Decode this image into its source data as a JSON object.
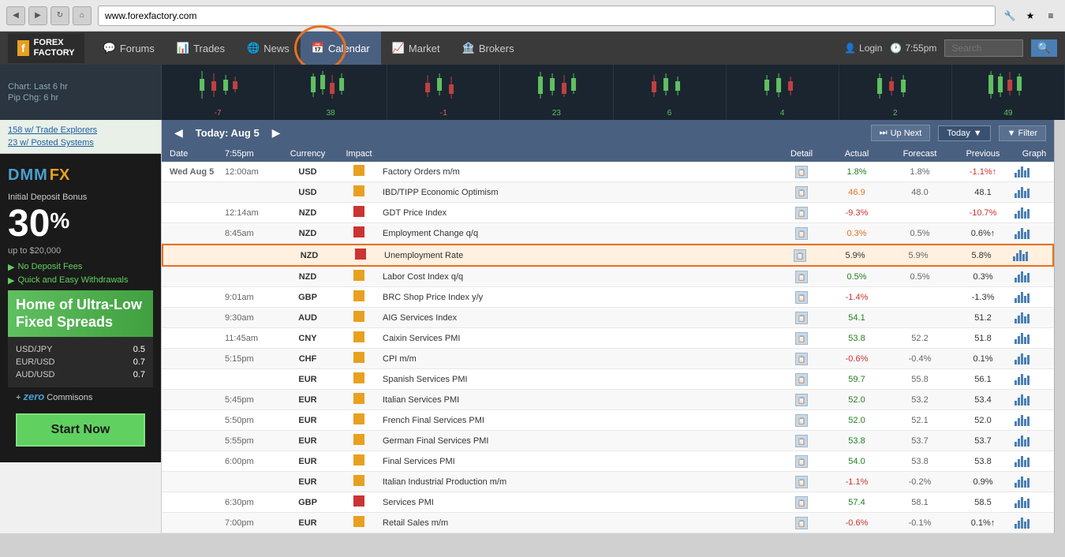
{
  "browser": {
    "url": "www.forexfactory.com",
    "back_btn": "◀",
    "forward_btn": "▶",
    "reload_btn": "↻",
    "home_btn": "⌂"
  },
  "nav": {
    "logo_f": "f",
    "logo_line1": "FOREX",
    "logo_line2": "FACTORY",
    "forums_label": "Forums",
    "trades_label": "Trades",
    "news_label": "News",
    "calendar_label": "Calendar",
    "market_label": "Market",
    "brokers_label": "Brokers",
    "login_label": "Login",
    "time_label": "7:55pm",
    "search_placeholder": "Search"
  },
  "chart": {
    "label": "Chart: Last 6 hr",
    "pip_label": "Pip Chg: 6 hr",
    "columns": [
      {
        "pip": "-7",
        "pip_class": "pip-neg"
      },
      {
        "pip": "38",
        "pip_class": "pip-pos"
      },
      {
        "pip": "-1",
        "pip_class": "pip-neg"
      },
      {
        "pip": "23",
        "pip_class": "pip-pos"
      },
      {
        "pip": "6",
        "pip_class": "pip-pos"
      },
      {
        "pip": "4",
        "pip_class": "pip-pos"
      },
      {
        "pip": "2",
        "pip_class": "pip-pos"
      },
      {
        "pip": "49",
        "pip_class": "pip-pos"
      }
    ]
  },
  "sidebar": {
    "link1": "158 w/ Trade Explorers",
    "link2": "23 w/ Posted Systems",
    "ad": {
      "brand": "DMM",
      "brand_fx": "FX",
      "bonus_text": "Initial Deposit Bonus",
      "percent": "30",
      "percent_sign": "%",
      "upto": "up to $20,000",
      "feature1": "No Deposit Fees",
      "feature2": "Quick and Easy Withdrawals",
      "headline": "Home of Ultra-Low Fixed Spreads",
      "spread1_pair": "USD/JPY",
      "spread1_val": "0.5",
      "spread2_pair": "EUR/USD",
      "spread2_val": "0.7",
      "spread3_pair": "AUD/USD",
      "spread3_val": "0.7",
      "commission_prefix": "+ ",
      "commission_zero": "zero",
      "commission_suffix": " Commisons",
      "start_btn": "Start Now"
    }
  },
  "calendar": {
    "nav_prev": "◀",
    "nav_today": "Today: Aug 5",
    "nav_next": "▶",
    "upnext_label": "Up Next",
    "today_label": "Today",
    "filter_label": "Filter",
    "headers": {
      "date": "Date",
      "time": "7:55pm",
      "currency": "Currency",
      "impact": "Impact",
      "event": "",
      "detail": "Detail",
      "actual": "Actual",
      "forecast": "Forecast",
      "previous": "Previous",
      "graph": "Graph"
    },
    "rows": [
      {
        "date": "Wed Aug 5",
        "time": "12:00am",
        "currency": "USD",
        "impact": "med",
        "event": "Factory Orders m/m",
        "actual": "1.8%",
        "actual_class": "val-positive",
        "forecast": "1.8%",
        "previous": "-1.1%↑",
        "prev_class": "val-negative"
      },
      {
        "date": "",
        "time": "",
        "currency": "USD",
        "impact": "med",
        "event": "IBD/TIPP Economic Optimism",
        "actual": "46.9",
        "actual_class": "val-orange",
        "forecast": "48.0",
        "previous": "48.1",
        "prev_class": "val-neutral"
      },
      {
        "date": "",
        "time": "12:14am",
        "currency": "NZD",
        "impact": "high",
        "event": "GDT Price Index",
        "actual": "-9.3%",
        "actual_class": "val-negative",
        "forecast": "",
        "previous": "-10.7%",
        "prev_class": "val-negative"
      },
      {
        "date": "",
        "time": "8:45am",
        "currency": "NZD",
        "impact": "high",
        "event": "Employment Change q/q",
        "actual": "0.3%",
        "actual_class": "val-orange",
        "forecast": "0.5%",
        "previous": "0.6%↑",
        "prev_class": "val-neutral"
      },
      {
        "date": "",
        "time": "",
        "currency": "NZD",
        "impact": "high",
        "event": "Unemployment Rate",
        "actual": "5.9%",
        "actual_class": "val-neutral",
        "forecast": "5.9%",
        "previous": "5.8%",
        "prev_class": "val-neutral",
        "highlighted": true
      },
      {
        "date": "",
        "time": "",
        "currency": "NZD",
        "impact": "med",
        "event": "Labor Cost Index q/q",
        "actual": "0.5%",
        "actual_class": "val-positive",
        "forecast": "0.5%",
        "previous": "0.3%",
        "prev_class": "val-neutral"
      },
      {
        "date": "",
        "time": "9:01am",
        "currency": "GBP",
        "impact": "med",
        "event": "BRC Shop Price Index y/y",
        "actual": "-1.4%",
        "actual_class": "val-negative",
        "forecast": "",
        "previous": "-1.3%",
        "prev_class": "val-neutral"
      },
      {
        "date": "",
        "time": "9:30am",
        "currency": "AUD",
        "impact": "med",
        "event": "AIG Services Index",
        "actual": "54.1",
        "actual_class": "val-positive",
        "forecast": "",
        "previous": "51.2",
        "prev_class": "val-neutral"
      },
      {
        "date": "",
        "time": "11:45am",
        "currency": "CNY",
        "impact": "med",
        "event": "Caixin Services PMI",
        "actual": "53.8",
        "actual_class": "val-positive",
        "forecast": "52.2",
        "previous": "51.8",
        "prev_class": "val-neutral"
      },
      {
        "date": "",
        "time": "5:15pm",
        "currency": "CHF",
        "impact": "med",
        "event": "CPI m/m",
        "actual": "-0.6%",
        "actual_class": "val-negative",
        "forecast": "-0.4%",
        "previous": "0.1%",
        "prev_class": "val-neutral"
      },
      {
        "date": "",
        "time": "",
        "currency": "EUR",
        "impact": "med",
        "event": "Spanish Services PMI",
        "actual": "59.7",
        "actual_class": "val-positive",
        "forecast": "55.8",
        "previous": "56.1",
        "prev_class": "val-neutral"
      },
      {
        "date": "",
        "time": "5:45pm",
        "currency": "EUR",
        "impact": "med",
        "event": "Italian Services PMI",
        "actual": "52.0",
        "actual_class": "val-positive",
        "forecast": "53.2",
        "previous": "53.4",
        "prev_class": "val-neutral"
      },
      {
        "date": "",
        "time": "5:50pm",
        "currency": "EUR",
        "impact": "med",
        "event": "French Final Services PMI",
        "actual": "52.0",
        "actual_class": "val-positive",
        "forecast": "52.1",
        "previous": "52.0",
        "prev_class": "val-neutral"
      },
      {
        "date": "",
        "time": "5:55pm",
        "currency": "EUR",
        "impact": "med",
        "event": "German Final Services PMI",
        "actual": "53.8",
        "actual_class": "val-positive",
        "forecast": "53.7",
        "previous": "53.7",
        "prev_class": "val-neutral"
      },
      {
        "date": "",
        "time": "6:00pm",
        "currency": "EUR",
        "impact": "med",
        "event": "Final Services PMI",
        "actual": "54.0",
        "actual_class": "val-positive",
        "forecast": "53.8",
        "previous": "53.8",
        "prev_class": "val-neutral"
      },
      {
        "date": "",
        "time": "",
        "currency": "EUR",
        "impact": "med",
        "event": "Italian Industrial Production m/m",
        "actual": "-1.1%",
        "actual_class": "val-negative",
        "forecast": "-0.2%",
        "previous": "0.9%",
        "prev_class": "val-neutral"
      },
      {
        "date": "",
        "time": "6:30pm",
        "currency": "GBP",
        "impact": "high",
        "event": "Services PMI",
        "actual": "57.4",
        "actual_class": "val-positive",
        "forecast": "58.1",
        "previous": "58.5",
        "prev_class": "val-neutral"
      },
      {
        "date": "",
        "time": "7:00pm",
        "currency": "EUR",
        "impact": "med",
        "event": "Retail Sales m/m",
        "actual": "-0.6%",
        "actual_class": "val-negative",
        "forecast": "-0.1%",
        "previous": "0.1%↑",
        "prev_class": "val-neutral"
      }
    ]
  }
}
